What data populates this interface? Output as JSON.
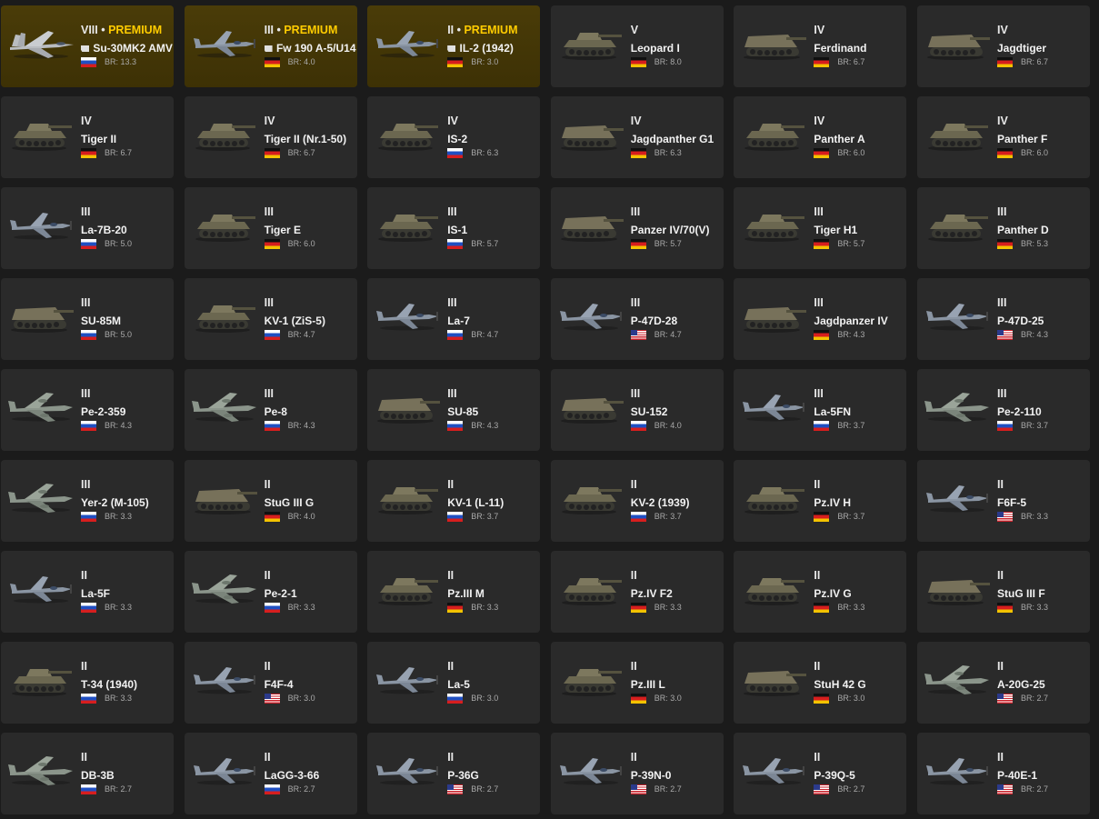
{
  "vehicles": [
    {
      "rank": "VIII",
      "premium": true,
      "premium_label": "PREMIUM",
      "name": "Su-30MK2 AMV",
      "nation": "ussr",
      "nation_name": "USSR",
      "br": "BR: 13.3",
      "type": "jet"
    },
    {
      "rank": "III",
      "premium": true,
      "premium_label": "PREMIUM",
      "name": "Fw 190 A-5/U14",
      "nation": "germany",
      "nation_name": "Germany",
      "br": "BR: 4.0",
      "type": "plane"
    },
    {
      "rank": "II",
      "premium": true,
      "premium_label": "PREMIUM",
      "name": "IL-2 (1942)",
      "nation": "germany",
      "nation_name": "Germany",
      "br": "BR: 3.0",
      "type": "plane"
    },
    {
      "rank": "V",
      "premium": false,
      "name": "Leopard I",
      "nation": "germany",
      "nation_name": "Germany",
      "br": "BR: 8.0",
      "type": "tank"
    },
    {
      "rank": "IV",
      "premium": false,
      "name": "Ferdinand",
      "nation": "germany",
      "nation_name": "Germany",
      "br": "BR: 6.7",
      "type": "spg"
    },
    {
      "rank": "IV",
      "premium": false,
      "name": "Jagdtiger",
      "nation": "germany",
      "nation_name": "Germany",
      "br": "BR: 6.7",
      "type": "spg"
    },
    {
      "rank": "IV",
      "premium": false,
      "name": "Tiger II",
      "nation": "germany",
      "nation_name": "Germany",
      "br": "BR: 6.7",
      "type": "tank"
    },
    {
      "rank": "IV",
      "premium": false,
      "name": "Tiger II (Nr.1-50)",
      "nation": "germany",
      "nation_name": "Germany",
      "br": "BR: 6.7",
      "type": "tank"
    },
    {
      "rank": "IV",
      "premium": false,
      "name": "IS-2",
      "nation": "ussr",
      "nation_name": "USSR",
      "br": "BR: 6.3",
      "type": "tank"
    },
    {
      "rank": "IV",
      "premium": false,
      "name": "Jagdpanther G1",
      "nation": "germany",
      "nation_name": "Germany",
      "br": "BR: 6.3",
      "type": "spg"
    },
    {
      "rank": "IV",
      "premium": false,
      "name": "Panther A",
      "nation": "germany",
      "nation_name": "Germany",
      "br": "BR: 6.0",
      "type": "tank"
    },
    {
      "rank": "IV",
      "premium": false,
      "name": "Panther F",
      "nation": "germany",
      "nation_name": "Germany",
      "br": "BR: 6.0",
      "type": "tank"
    },
    {
      "rank": "III",
      "premium": false,
      "name": "La-7B-20",
      "nation": "ussr",
      "nation_name": "USSR",
      "br": "BR: 5.0",
      "type": "plane"
    },
    {
      "rank": "III",
      "premium": false,
      "name": "Tiger E",
      "nation": "germany",
      "nation_name": "Germany",
      "br": "BR: 6.0",
      "type": "tank"
    },
    {
      "rank": "III",
      "premium": false,
      "name": "IS-1",
      "nation": "ussr",
      "nation_name": "USSR",
      "br": "BR: 5.7",
      "type": "tank"
    },
    {
      "rank": "III",
      "premium": false,
      "name": "Panzer IV/70(V)",
      "nation": "germany",
      "nation_name": "Germany",
      "br": "BR: 5.7",
      "type": "spg"
    },
    {
      "rank": "III",
      "premium": false,
      "name": "Tiger H1",
      "nation": "germany",
      "nation_name": "Germany",
      "br": "BR: 5.7",
      "type": "tank"
    },
    {
      "rank": "III",
      "premium": false,
      "name": "Panther D",
      "nation": "germany",
      "nation_name": "Germany",
      "br": "BR: 5.3",
      "type": "tank"
    },
    {
      "rank": "III",
      "premium": false,
      "name": "SU-85M",
      "nation": "ussr",
      "nation_name": "USSR",
      "br": "BR: 5.0",
      "type": "spg"
    },
    {
      "rank": "III",
      "premium": false,
      "name": "KV-1 (ZiS-5)",
      "nation": "ussr",
      "nation_name": "USSR",
      "br": "BR: 4.7",
      "type": "tank"
    },
    {
      "rank": "III",
      "premium": false,
      "name": "La-7",
      "nation": "ussr",
      "nation_name": "USSR",
      "br": "BR: 4.7",
      "type": "plane"
    },
    {
      "rank": "III",
      "premium": false,
      "name": "P-47D-28",
      "nation": "usa",
      "nation_name": "USA",
      "br": "BR: 4.7",
      "type": "plane"
    },
    {
      "rank": "III",
      "premium": false,
      "name": "Jagdpanzer IV",
      "nation": "germany",
      "nation_name": "Germany",
      "br": "BR: 4.3",
      "type": "spg"
    },
    {
      "rank": "III",
      "premium": false,
      "name": "P-47D-25",
      "nation": "usa",
      "nation_name": "USA",
      "br": "BR: 4.3",
      "type": "plane"
    },
    {
      "rank": "III",
      "premium": false,
      "name": "Pe-2-359",
      "nation": "ussr",
      "nation_name": "USSR",
      "br": "BR: 4.3",
      "type": "bomber"
    },
    {
      "rank": "III",
      "premium": false,
      "name": "Pe-8",
      "nation": "ussr",
      "nation_name": "USSR",
      "br": "BR: 4.3",
      "type": "bomber"
    },
    {
      "rank": "III",
      "premium": false,
      "name": "SU-85",
      "nation": "ussr",
      "nation_name": "USSR",
      "br": "BR: 4.3",
      "type": "spg"
    },
    {
      "rank": "III",
      "premium": false,
      "name": "SU-152",
      "nation": "ussr",
      "nation_name": "USSR",
      "br": "BR: 4.0",
      "type": "spg"
    },
    {
      "rank": "III",
      "premium": false,
      "name": "La-5FN",
      "nation": "ussr",
      "nation_name": "USSR",
      "br": "BR: 3.7",
      "type": "plane"
    },
    {
      "rank": "III",
      "premium": false,
      "name": "Pe-2-110",
      "nation": "ussr",
      "nation_name": "USSR",
      "br": "BR: 3.7",
      "type": "bomber"
    },
    {
      "rank": "III",
      "premium": false,
      "name": "Yer-2 (M-105)",
      "nation": "ussr",
      "nation_name": "USSR",
      "br": "BR: 3.3",
      "type": "bomber"
    },
    {
      "rank": "II",
      "premium": false,
      "name": "StuG III G",
      "nation": "germany",
      "nation_name": "Germany",
      "br": "BR: 4.0",
      "type": "spg"
    },
    {
      "rank": "II",
      "premium": false,
      "name": "KV-1 (L-11)",
      "nation": "ussr",
      "nation_name": "USSR",
      "br": "BR: 3.7",
      "type": "tank"
    },
    {
      "rank": "II",
      "premium": false,
      "name": "KV-2 (1939)",
      "nation": "ussr",
      "nation_name": "USSR",
      "br": "BR: 3.7",
      "type": "tank"
    },
    {
      "rank": "II",
      "premium": false,
      "name": "Pz.IV H",
      "nation": "germany",
      "nation_name": "Germany",
      "br": "BR: 3.7",
      "type": "tank"
    },
    {
      "rank": "II",
      "premium": false,
      "name": "F6F-5",
      "nation": "usa",
      "nation_name": "USA",
      "br": "BR: 3.3",
      "type": "plane"
    },
    {
      "rank": "II",
      "premium": false,
      "name": "La-5F",
      "nation": "ussr",
      "nation_name": "USSR",
      "br": "BR: 3.3",
      "type": "plane"
    },
    {
      "rank": "II",
      "premium": false,
      "name": "Pe-2-1",
      "nation": "ussr",
      "nation_name": "USSR",
      "br": "BR: 3.3",
      "type": "bomber"
    },
    {
      "rank": "II",
      "premium": false,
      "name": "Pz.III M",
      "nation": "germany",
      "nation_name": "Germany",
      "br": "BR: 3.3",
      "type": "tank"
    },
    {
      "rank": "II",
      "premium": false,
      "name": "Pz.IV F2",
      "nation": "germany",
      "nation_name": "Germany",
      "br": "BR: 3.3",
      "type": "tank"
    },
    {
      "rank": "II",
      "premium": false,
      "name": "Pz.IV G",
      "nation": "germany",
      "nation_name": "Germany",
      "br": "BR: 3.3",
      "type": "tank"
    },
    {
      "rank": "II",
      "premium": false,
      "name": "StuG III F",
      "nation": "germany",
      "nation_name": "Germany",
      "br": "BR: 3.3",
      "type": "spg"
    },
    {
      "rank": "II",
      "premium": false,
      "name": "T-34 (1940)",
      "nation": "ussr",
      "nation_name": "USSR",
      "br": "BR: 3.3",
      "type": "tank"
    },
    {
      "rank": "II",
      "premium": false,
      "name": "F4F-4",
      "nation": "usa",
      "nation_name": "USA",
      "br": "BR: 3.0",
      "type": "plane"
    },
    {
      "rank": "II",
      "premium": false,
      "name": "La-5",
      "nation": "ussr",
      "nation_name": "USSR",
      "br": "BR: 3.0",
      "type": "plane"
    },
    {
      "rank": "II",
      "premium": false,
      "name": "Pz.III L",
      "nation": "germany",
      "nation_name": "Germany",
      "br": "BR: 3.0",
      "type": "tank"
    },
    {
      "rank": "II",
      "premium": false,
      "name": "StuH 42 G",
      "nation": "germany",
      "nation_name": "Germany",
      "br": "BR: 3.0",
      "type": "spg"
    },
    {
      "rank": "II",
      "premium": false,
      "name": "A-20G-25",
      "nation": "usa",
      "nation_name": "USA",
      "br": "BR: 2.7",
      "type": "bomber"
    },
    {
      "rank": "II",
      "premium": false,
      "name": "DB-3B",
      "nation": "ussr",
      "nation_name": "USSR",
      "br": "BR: 2.7",
      "type": "bomber"
    },
    {
      "rank": "II",
      "premium": false,
      "name": "LaGG-3-66",
      "nation": "ussr",
      "nation_name": "USSR",
      "br": "BR: 2.7",
      "type": "plane"
    },
    {
      "rank": "II",
      "premium": false,
      "name": "P-36G",
      "nation": "usa",
      "nation_name": "USA",
      "br": "BR: 2.7",
      "type": "plane"
    },
    {
      "rank": "II",
      "premium": false,
      "name": "P-39N-0",
      "nation": "usa",
      "nation_name": "USA",
      "br": "BR: 2.7",
      "type": "plane"
    },
    {
      "rank": "II",
      "premium": false,
      "name": "P-39Q-5",
      "nation": "usa",
      "nation_name": "USA",
      "br": "BR: 2.7",
      "type": "plane"
    },
    {
      "rank": "II",
      "premium": false,
      "name": "P-40E-1",
      "nation": "usa",
      "nation_name": "USA",
      "br": "BR: 2.7",
      "type": "plane"
    }
  ],
  "colors": {
    "background": "#1b1b1b",
    "card": "#2a2a2a",
    "premium_card": "#3d3105",
    "premium_text": "#ffcc00",
    "br_text": "#a9a9a9"
  }
}
